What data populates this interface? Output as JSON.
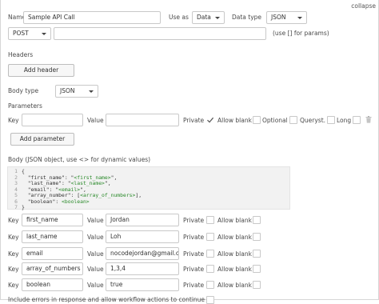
{
  "collapse_label": "collapse",
  "call": {
    "name_label": "Name",
    "name_value": "Sample API Call",
    "use_as_label": "Use as",
    "use_as_value": "Data",
    "data_type_label": "Data type",
    "data_type_value": "JSON",
    "method_value": "POST",
    "url_value": "",
    "url_hint": "(use [] for params)"
  },
  "headers": {
    "section_label": "Headers",
    "add_button": "Add header"
  },
  "body_type": {
    "label": "Body type",
    "value": "JSON"
  },
  "parameters": {
    "section_label": "Parameters",
    "key_label": "Key",
    "value_label": "Value",
    "private_label": "Private",
    "allow_blank_label": "Allow blank",
    "optional_label": "Optional",
    "querystring_label": "Queryst.",
    "long_label": "Long",
    "add_button": "Add parameter"
  },
  "body_section": {
    "label": "Body (JSON object, use <> for dynamic values)",
    "code_lines": [
      {
        "num": "1",
        "text": "{"
      },
      {
        "num": "2",
        "text": "  \"first_name\": \"<first_name>\","
      },
      {
        "num": "3",
        "text": "  \"last_name\": \"<last_name>\","
      },
      {
        "num": "4",
        "text": "  \"email\": \"<email>\","
      },
      {
        "num": "5",
        "text": "  \"array_number\": [<array_of_numbers>],"
      },
      {
        "num": "6",
        "text": "  \"boolean\": <boolean>"
      },
      {
        "num": "7",
        "text": "}"
      }
    ]
  },
  "body_params": [
    {
      "key_label": "Key",
      "key": "first_name",
      "value_label": "Value",
      "value": "Jordan",
      "private_label": "Private",
      "allow_blank_label": "Allow blank"
    },
    {
      "key_label": "Key",
      "key": "last_name",
      "value_label": "Value",
      "value": "Loh",
      "private_label": "Private",
      "allow_blank_label": "Allow blank"
    },
    {
      "key_label": "Key",
      "key": "email",
      "value_label": "Value",
      "value": "nocodejordan@gmail.com",
      "private_label": "Private",
      "allow_blank_label": "Allow blank"
    },
    {
      "key_label": "Key",
      "key": "array_of_numbers",
      "value_label": "Value",
      "value": "1,3,4",
      "private_label": "Private",
      "allow_blank_label": "Allow blank"
    },
    {
      "key_label": "Key",
      "key": "boolean",
      "value_label": "Value",
      "value": "true",
      "private_label": "Private",
      "allow_blank_label": "Allow blank"
    }
  ],
  "footer_text": "Include errors in response and allow workflow actions to continue",
  "colors": {
    "check": "#555555",
    "code_string": "#2a8a2a",
    "code_bg": "#f2f2f2"
  }
}
